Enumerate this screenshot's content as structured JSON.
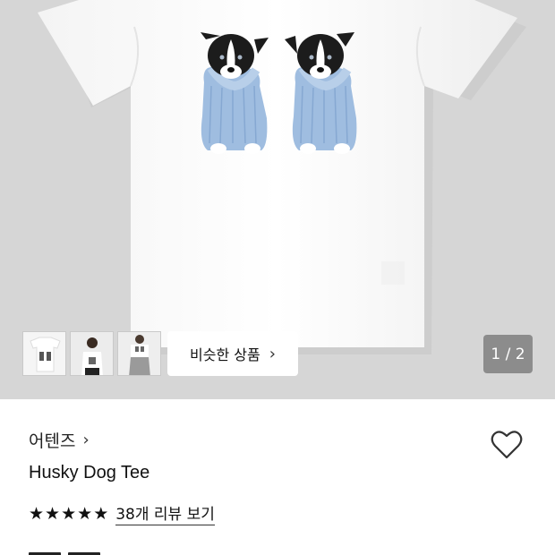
{
  "gallery": {
    "similar_label": "비슷한 상품",
    "counter": "1 / 2",
    "current_image": 1,
    "total_images": 2,
    "thumbnail_count": 3
  },
  "product": {
    "brand": "어텐즈",
    "title": "Husky Dog Tee",
    "rating": 5,
    "review_link": "38개 리뷰 보기"
  },
  "colors": {
    "hero_background": "#d6d6d6",
    "counter_background": "#8c8c8c"
  },
  "icons": {
    "brand_chevron": "chevron-right-icon",
    "similar_chevron": "chevron-right-icon",
    "wishlist": "heart-icon",
    "star": "star-icon"
  }
}
